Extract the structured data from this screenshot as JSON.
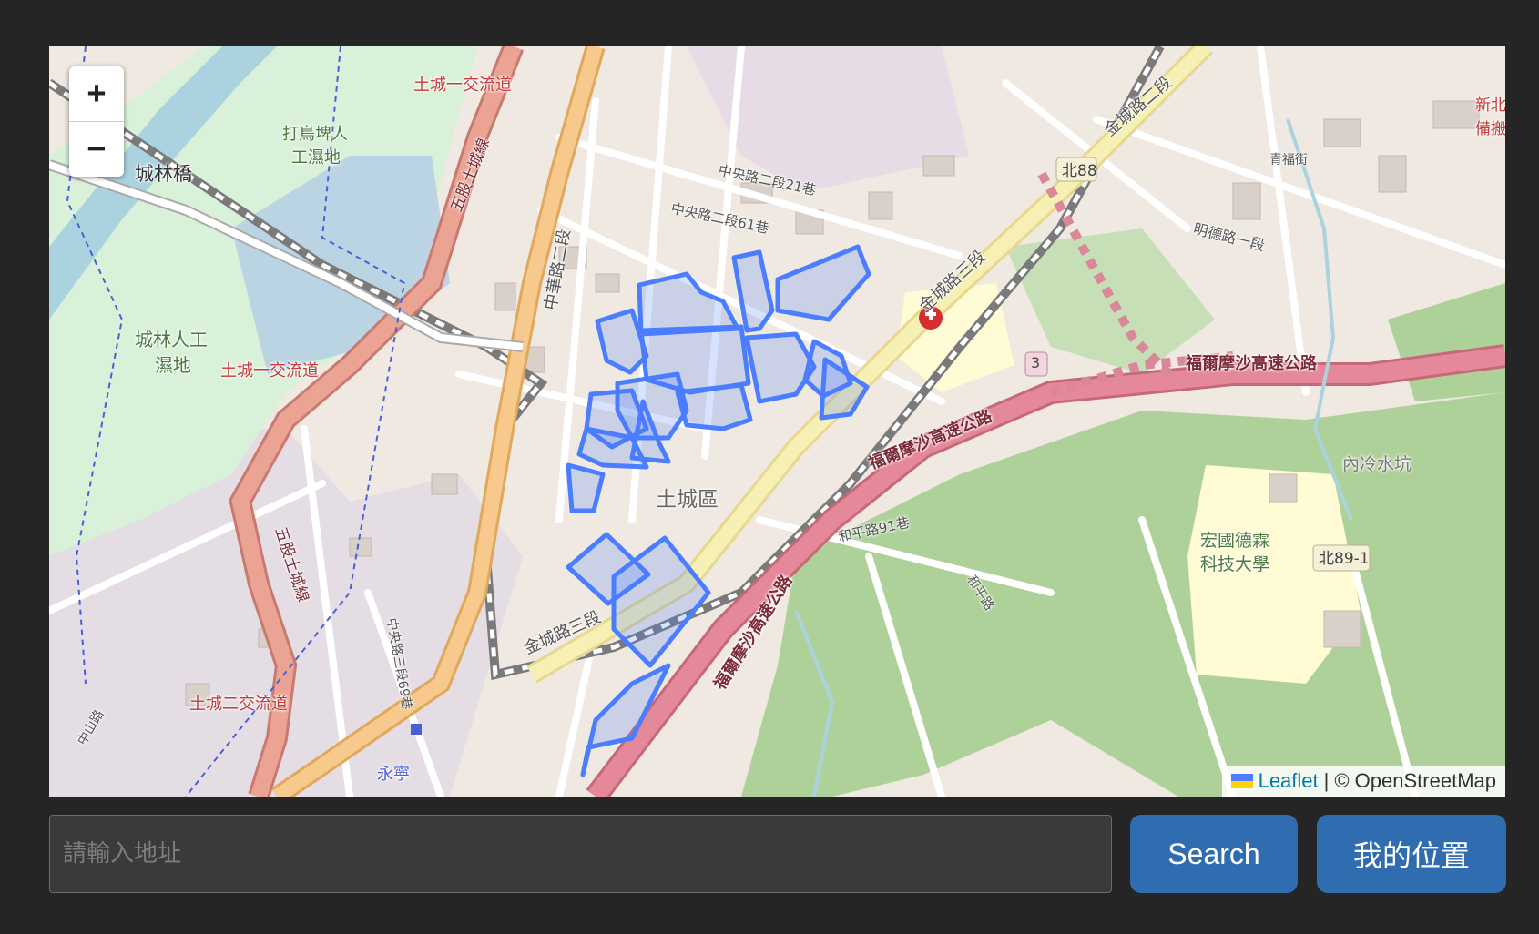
{
  "map": {
    "zoom_in_label": "+",
    "zoom_out_label": "−",
    "attribution": {
      "leaflet": "Leaflet",
      "separator": "|",
      "osm": "© OpenStreetMap"
    },
    "flag_colors": [
      "#4f7cff",
      "#ffd500"
    ],
    "highlight_color": "#4a7dff",
    "labels": [
      {
        "id": "chenglin-bridge",
        "text": "城林橋"
      },
      {
        "id": "interchange-1-top",
        "text": "土城一交流道"
      },
      {
        "id": "interchange-1-mid",
        "text": "土城一交流道"
      },
      {
        "id": "interchange-2",
        "text": "土城二交流道"
      },
      {
        "id": "wetland-1",
        "text": "城林人工"
      },
      {
        "id": "wetland-2",
        "text": "濕地"
      },
      {
        "id": "dabird-1",
        "text": "打鳥埤人"
      },
      {
        "id": "dabird-2",
        "text": "工濕地"
      },
      {
        "id": "district",
        "text": "土城區"
      },
      {
        "id": "university-1",
        "text": "宏國德霖"
      },
      {
        "id": "university-2",
        "text": "科技大學"
      },
      {
        "id": "neileng",
        "text": "內冷水坑"
      },
      {
        "id": "fwy-1",
        "text": "福爾摩沙高速公路"
      },
      {
        "id": "fwy-2",
        "text": "福爾摩沙高速公路"
      },
      {
        "id": "fwy-3",
        "text": "福爾摩沙高速公路"
      },
      {
        "id": "jincheng-3a",
        "text": "金城路三段"
      },
      {
        "id": "jincheng-3b",
        "text": "金城路三段"
      },
      {
        "id": "jincheng-2",
        "text": "金城路二段"
      },
      {
        "id": "zhonghua-2",
        "text": "中華路二段"
      },
      {
        "id": "zhongyang-2-21",
        "text": "中央路二段21巷"
      },
      {
        "id": "zhongyang-2-61",
        "text": "中央路二段61巷"
      },
      {
        "id": "mingde-1",
        "text": "明德路一段"
      },
      {
        "id": "qingfu",
        "text": "青福街"
      },
      {
        "id": "peace-91",
        "text": "和平路91巷"
      },
      {
        "id": "peace",
        "text": "和平路"
      },
      {
        "id": "bei88",
        "text": "北88"
      },
      {
        "id": "bei89-1",
        "text": "北89-1"
      },
      {
        "id": "route3",
        "text": "3"
      },
      {
        "id": "yongning",
        "text": "永寧"
      },
      {
        "id": "wugu-1",
        "text": "五股土城線"
      },
      {
        "id": "wugu-2",
        "text": "五股土城線"
      },
      {
        "id": "gongrong",
        "text": "中央路三段69巷"
      },
      {
        "id": "zhongshan",
        "text": "中山路"
      },
      {
        "id": "xinbei",
        "text": "新北"
      },
      {
        "id": "beishe",
        "text": "備搬"
      }
    ]
  },
  "search": {
    "placeholder": "請輸入地址",
    "value": "",
    "button_label": "Search",
    "location_label": "我的位置"
  }
}
